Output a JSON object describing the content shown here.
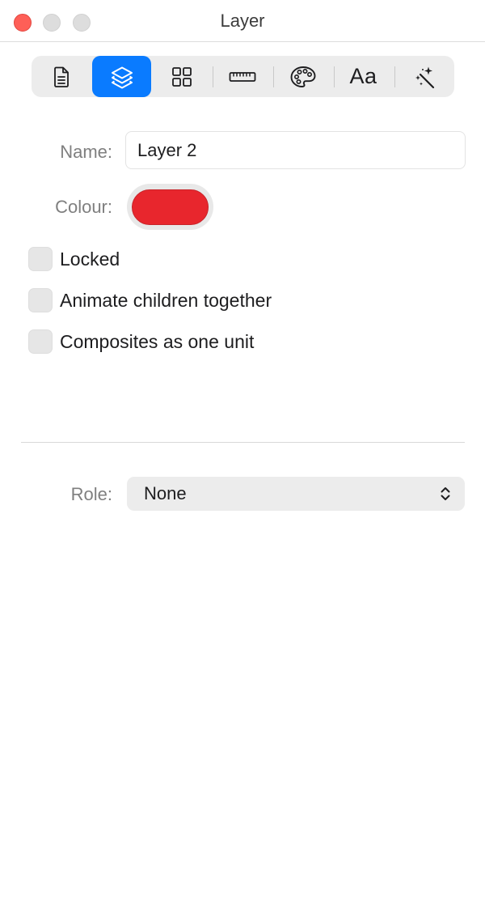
{
  "window": {
    "title": "Layer"
  },
  "toolbar": {
    "items": [
      {
        "icon": "document-icon",
        "active": false
      },
      {
        "icon": "layers-icon",
        "active": true
      },
      {
        "icon": "grid-icon",
        "active": false
      },
      {
        "icon": "ruler-icon",
        "active": false
      },
      {
        "icon": "palette-icon",
        "active": false
      },
      {
        "icon": "text-style-icon",
        "label": "Aa",
        "active": false
      },
      {
        "icon": "magic-wand-icon",
        "active": false
      }
    ],
    "active_color": "#0a7bff"
  },
  "form": {
    "name_label": "Name:",
    "name_value": "Layer 2",
    "colour_label": "Colour:",
    "colour_value": "#e8262d"
  },
  "options": [
    {
      "label": "Locked",
      "checked": false
    },
    {
      "label": "Animate children together",
      "checked": false
    },
    {
      "label": "Composites as one unit",
      "checked": false
    }
  ],
  "role": {
    "label": "Role:",
    "value": "None"
  }
}
